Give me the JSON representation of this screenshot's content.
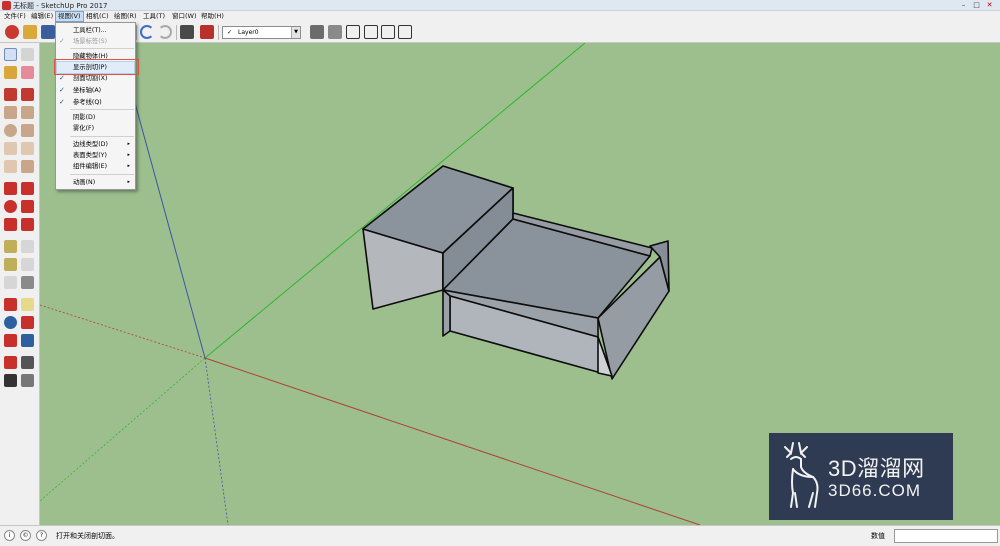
{
  "window": {
    "title": "无标题 - SketchUp Pro 2017",
    "minimize": "–",
    "maximize": "□",
    "close": "✕"
  },
  "menubar": {
    "items": [
      {
        "label": "文件(F)"
      },
      {
        "label": "编辑(E)"
      },
      {
        "label": "视图(V)"
      },
      {
        "label": "相机(C)"
      },
      {
        "label": "绘图(R)"
      },
      {
        "label": "工具(T)"
      },
      {
        "label": "窗口(W)"
      },
      {
        "label": "帮助(H)"
      }
    ]
  },
  "toolbar": {
    "layer_check": "✓",
    "layer_name": "Layer0",
    "layer_arrow": "▼"
  },
  "view_menu": {
    "items": [
      {
        "label": "工具栏(T)...",
        "checked": false,
        "disabled": false,
        "submenu": false
      },
      {
        "label": "场景标签(S)",
        "checked": true,
        "disabled": true,
        "submenu": false
      },
      {
        "label": "隐藏物体(H)",
        "checked": false,
        "disabled": false,
        "submenu": false
      },
      {
        "label": "显示剖切(P)",
        "checked": false,
        "disabled": false,
        "submenu": false
      },
      {
        "label": "剖面切割(X)",
        "checked": true,
        "disabled": false,
        "submenu": false
      },
      {
        "label": "坐标轴(A)",
        "checked": true,
        "disabled": false,
        "submenu": false
      },
      {
        "label": "参考线(Q)",
        "checked": true,
        "disabled": false,
        "submenu": false
      },
      {
        "label": "阴影(D)",
        "checked": false,
        "disabled": false,
        "submenu": false
      },
      {
        "label": "雾化(F)",
        "checked": false,
        "disabled": false,
        "submenu": false
      },
      {
        "label": "边线类型(D)",
        "checked": false,
        "disabled": false,
        "submenu": true
      },
      {
        "label": "表面类型(Y)",
        "checked": false,
        "disabled": false,
        "submenu": true
      },
      {
        "label": "组件编辑(E)",
        "checked": false,
        "disabled": false,
        "submenu": true
      },
      {
        "label": "动画(N)",
        "checked": false,
        "disabled": false,
        "submenu": true
      }
    ],
    "check_glyph": "✓",
    "submenu_glyph": "▸"
  },
  "statusbar": {
    "hint": "打开和关闭剖切面。",
    "measurements_label": "数值",
    "icon_info": "i",
    "icon_user": "©",
    "icon_help": "?"
  },
  "watermark": {
    "line1": "3D溜溜网",
    "line2": "3D66.COM"
  },
  "colors": {
    "viewport_bg": "#9dbf8e",
    "model_top": "#8a929b",
    "model_side": "#b4b8bd",
    "axis_red": "#b0402c",
    "axis_green": "#2fb52f",
    "axis_blue": "#3a55a8",
    "highlight": "#e0533f"
  }
}
